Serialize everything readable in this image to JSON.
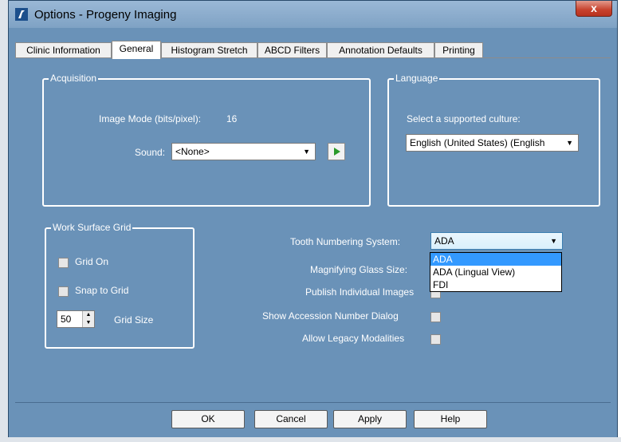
{
  "window": {
    "title": "Options - Progeny Imaging",
    "close_label": "x"
  },
  "tabs": [
    {
      "label": "Clinic Information"
    },
    {
      "label": "General"
    },
    {
      "label": "Histogram Stretch"
    },
    {
      "label": "ABCD Filters"
    },
    {
      "label": "Annotation Defaults"
    },
    {
      "label": "Printing"
    }
  ],
  "acquisition": {
    "title": "Acquisition",
    "image_mode_label": "Image Mode (bits/pixel):",
    "image_mode_value": "16",
    "sound_label": "Sound:",
    "sound_value": "<None>"
  },
  "language": {
    "title": "Language",
    "prompt": "Select a supported culture:",
    "culture_value": "English (United States) (English"
  },
  "grid": {
    "title": "Work Surface Grid",
    "grid_on_label": "Grid On",
    "snap_label": "Snap to Grid",
    "size_value": "50",
    "size_label": "Grid Size"
  },
  "options": {
    "tooth_label": "Tooth Numbering System:",
    "tooth_value": "ADA",
    "tooth_options": [
      "ADA",
      "ADA (Lingual View)",
      "FDI"
    ],
    "magnify_label": "Magnifying Glass Size:",
    "publish_label": "Publish Individual Images",
    "accession_label": "Show Accession Number Dialog",
    "legacy_label": "Allow Legacy Modalities"
  },
  "buttons": {
    "ok": "OK",
    "cancel": "Cancel",
    "apply": "Apply",
    "help": "Help"
  }
}
